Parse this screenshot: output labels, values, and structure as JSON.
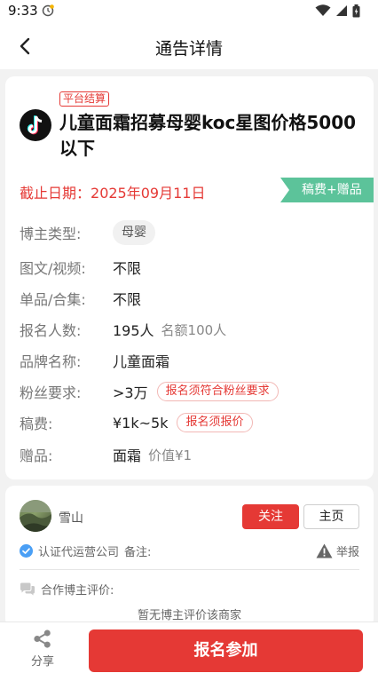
{
  "status_bar": {
    "time": "9:33"
  },
  "nav": {
    "title": "通告详情"
  },
  "notice": {
    "platform_badge": "平台结算",
    "title": "儿童面霜招募母婴koc星图价格5000以下",
    "deadline_label": "截止日期：",
    "deadline_date": "2025年09月11日",
    "reward_ribbon": "稿费+赠品",
    "fields": {
      "blogger_type": {
        "label": "博主类型:",
        "value": "母婴"
      },
      "media": {
        "label": "图文/视频:",
        "value": "不限"
      },
      "single": {
        "label": "单品/合集:",
        "value": "不限"
      },
      "signups": {
        "label": "报名人数:",
        "value": "195人",
        "sub": "名额100人"
      },
      "brand": {
        "label": "品牌名称:",
        "value": "儿童面霜"
      },
      "fans": {
        "label": "粉丝要求:",
        "value": ">3万",
        "tag": "报名须符合粉丝要求"
      },
      "fee": {
        "label": "稿费:",
        "value": "¥1k~5k",
        "tag": "报名须报价"
      },
      "gift": {
        "label": "赠品:",
        "value": "面霜",
        "sub": "价值¥1"
      }
    }
  },
  "merchant": {
    "name": "雪山",
    "follow_label": "关注",
    "home_label": "主页",
    "verified_text": "认证代运营公司",
    "remark_label": "备注:",
    "report_label": "举报",
    "review_header": "合作博主评价:",
    "review_empty": "暂无博主评价该商家"
  },
  "bottom": {
    "share_label": "分享",
    "signup_label": "报名参加"
  },
  "colors": {
    "accent_red": "#e53935",
    "ribbon_green": "#5cc39a",
    "verify_blue": "#4a9ff5"
  }
}
